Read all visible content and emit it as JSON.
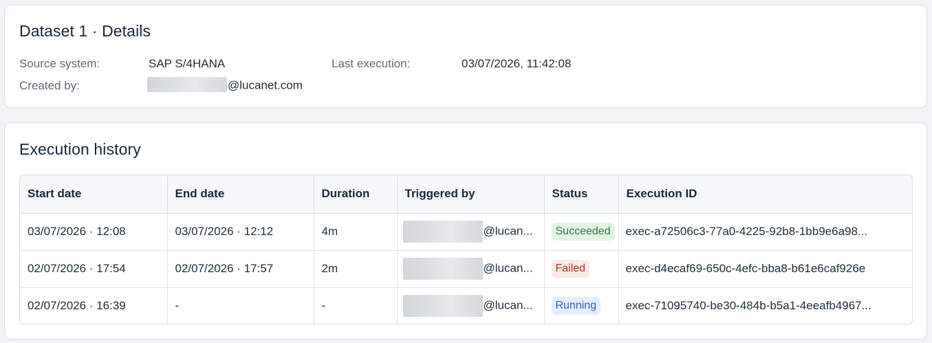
{
  "details": {
    "title": "Dataset 1 · Details",
    "source_label": "Source system:",
    "source_value": "SAP S/4HANA",
    "last_exec_label": "Last execution:",
    "last_exec_value": "03/07/2026, 11:42:08",
    "created_label": "Created by:",
    "created_value": "@lucanet.com"
  },
  "history": {
    "title": "Execution history",
    "columns": [
      "Start date",
      "End date",
      "Duration",
      "Triggered by",
      "Status",
      "Execution ID"
    ],
    "rows": [
      {
        "start": "03/07/2026 · 12:08",
        "end": "03/07/2026 · 12:12",
        "duration": "4m",
        "triggered": "@lucan...",
        "status": "Succeeded",
        "exec_id": "exec-a72506c3-77a0-4225-92b8-1bb9e6a98..."
      },
      {
        "start": "02/07/2026 · 17:54",
        "end": "02/07/2026 · 17:57",
        "duration": "2m",
        "triggered": "@lucan...",
        "status": "Failed",
        "exec_id": "exec-d4ecaf69-650c-4efc-bba8-b61e6caf926e"
      },
      {
        "start": "02/07/2026 · 16:39",
        "end": "-",
        "duration": "-",
        "triggered": "@lucan...",
        "status": "Running",
        "exec_id": "exec-71095740-be30-484b-b5a1-4eeafb4967..."
      }
    ]
  },
  "status_colors": {
    "Succeeded": {
      "bg": "#e3f3e6",
      "fg": "#2f7d3e"
    },
    "Failed": {
      "bg": "#fbe9e7",
      "fg": "#b4372a"
    },
    "Running": {
      "bg": "#e5eefb",
      "fg": "#2f63b3"
    }
  }
}
